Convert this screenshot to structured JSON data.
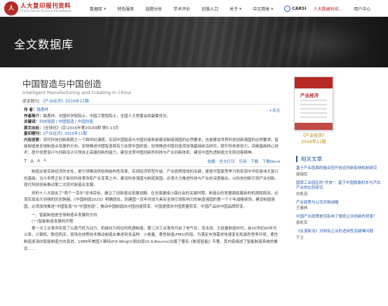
{
  "nav": {
    "logo_cn": "人大复印报刊资料",
    "logo_en": "China Social Science Excellence",
    "items": [
      {
        "label": "数据库",
        "caret": true
      },
      {
        "label": "特色服务",
        "caret": false
      },
      {
        "label": "选题分析",
        "caret": false
      },
      {
        "label": "学术评价",
        "caret": false
      },
      {
        "label": "旧版入口",
        "caret": false
      },
      {
        "label": "关于",
        "caret": true
      },
      {
        "label": "中文简体",
        "caret": true
      }
    ],
    "carsi": "CARSI",
    "user_link": "人大数据科技...",
    "user_center": "用户中心"
  },
  "banner": {
    "title": "全文数据库"
  },
  "article": {
    "title": "中国智造与中国创造",
    "en_title": "Intelligent Manufacturing and Creating in China",
    "source_prefix": "原发期刊：",
    "source_journal": "《产业经济》",
    "source_issue": "2016年11期",
    "follow": "+关注",
    "authors_label": "作 者：",
    "authors": "路甬祥",
    "affil_label": "作者简介：",
    "affil": "路甬祥，中国科学院院士，中国工程院院士，全国人大常委会原副委员长。",
    "keywords_label": "关键词：",
    "keywords": [
      "科技强国",
      "中国智造",
      "中国创造"
    ],
    "orig_label": "原文出处：",
    "orig": "《全球化》(京)2016年第20169期 第5-13页",
    "reprint_label": "复印期刊：",
    "reprint": "《产业经济》2016年11期",
    "content_label": "内容提要：",
    "content_lines": [
      "现代科技创新面貌之一个跨世纪课题，实现中国智造与中国创造既是建设制造强国的必然要求，也是建设世界科技创",
      "新强国的必然要求。智能制造是全球制造业发展的方向，加快推进中国智造将有力支撑中国创造，加快推进中国创造须加强基础",
      "前沿研究，提升科技原创力，突破基础核心技术；提升创意设计与创新设计引领自主高端创新的能力，建设支撑中国创新的科技",
      "与产业创新体系；建设中国先进制造文化和创客精神。"
    ],
    "font_sizes": [
      "T",
      "A",
      "A",
      "A"
    ],
    "actions": [
      "收藏",
      "全文打印",
      "引用",
      "下载",
      "下载Word"
    ],
    "paragraphs": [
      "制造业是实体经济的支柱，是引领推动供给侧结构性改革，实现经济转型升级、产业提质增效的关键，是提升国家竞争力和实现中华民族伟大复兴的基础。当今世界正处于新的科技革命和产业变革之中，建设科技强国与制造强国，必须大力推进科技与产业的深度融合，以科技创新引领产业创新。现代科技创新推动第二次现代制造业发展。",
      "党的十八大提出了\"两个一百年\"宏伟目标，确立了创新驱动发展战略。在全面建成小康社会的关键时期，制造业的发展面临着新的机遇和挑战，必须实现由大到强的历史跨越。《中国制造2025》明确提出，到建国一百年时成为具有全球引领影响力的制造强国的第一个十年战略纲领。建设制造强国，必须加快推进\"中国智造\"与\"中国创造\"，推动中国制造向中国创造转变、中国速度向中国质量转变、中国产品向中国品牌转变。"
    ],
    "subheads": [
      "一、智能制造是全球制造业发展的方向",
      "(一)智能制造发展的历程"
    ],
    "para3": "第一次工业革命实现了以蒸汽机为动力、机械化为特征的机器制造。第二次工业革命开启了电气化、流水线、大批量制造时代。自20世纪60年代以来，计算机、数控机床、现场总线等技术推动制造业推进到多品种、小批量、柔性制造(FMS)阶段。为满足市场需求快速变化和激烈竞争环境，柔性制造逐渐向智能制造方向演进。1988年美国人赖特(P.K.Wright)和伯恩(D.A.Bourne)出版了著名《制造智能》专著，其内容阐述了智能制造系统的概念……"
  },
  "sidebar": {
    "cover_name": "产业经济",
    "cover_journal": "《产业经济》",
    "cover_issue": "2016年11期",
    "related_head": "相关文章",
    "related": [
      {
        "title": "基于产业层面的融合型开放式创新影响机制研究",
        "author": "康瑞民"
      },
      {
        "title": "国家工业园区的\"开放\"：基于中国铁路机车与汽车产业的比较研究",
        "author": "刘凯亮"
      },
      {
        "title": "产业政策与公司并购战略",
        "author": "王春林"
      },
      {
        "title": "中国产业政策是否影响了微观企业创新的背景？",
        "author": "郝凯军"
      },
      {
        "title": "《反混新法》对网有企业的适用性及疑难问题",
        "author": "于立"
      }
    ]
  }
}
